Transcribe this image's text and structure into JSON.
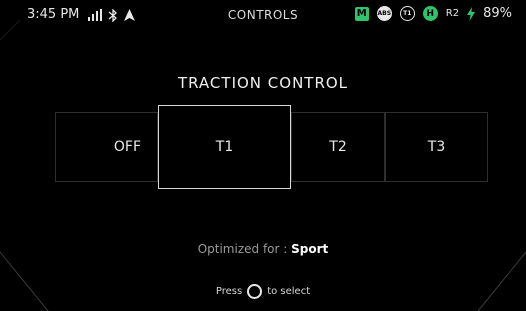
{
  "status": {
    "time": "3:45 PM",
    "title": "CONTROLS",
    "mode_badge": "M",
    "abs_label": "ABS",
    "t1_label": "T1",
    "h_label": "H",
    "r2_label": "R2",
    "battery": "89%",
    "accent": "#2ec46a"
  },
  "heading": "TRACTION CONTROL",
  "options": [
    {
      "label": "OFF"
    },
    {
      "label": "T1",
      "selected": true
    },
    {
      "label": "T2"
    },
    {
      "label": "T3"
    }
  ],
  "optimized_label": "Optimized for :",
  "optimized_value": "Sport",
  "press_prefix": "Press",
  "press_suffix": "to select"
}
